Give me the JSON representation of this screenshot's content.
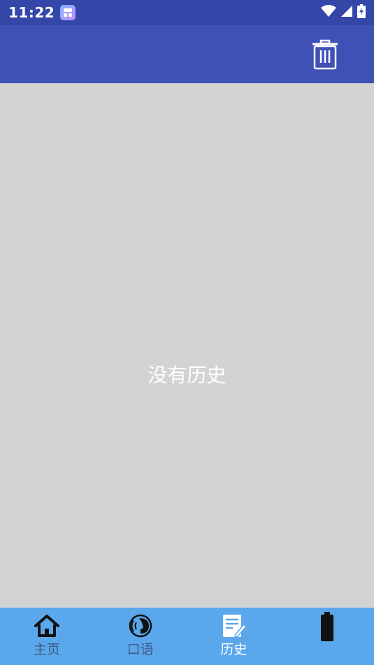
{
  "status_bar": {
    "time": "11:22",
    "icons": [
      "app-notification-icon",
      "wifi-icon",
      "signal-icon",
      "battery-charging-icon"
    ]
  },
  "toolbar": {
    "action_icon": "trash-icon"
  },
  "content": {
    "empty_message": "没有历史"
  },
  "bottom_nav": {
    "items": [
      {
        "label": "主页",
        "icon": "home-icon",
        "active": false
      },
      {
        "label": "口语",
        "icon": "speak-icon",
        "active": false
      },
      {
        "label": "历史",
        "icon": "history-icon",
        "active": true
      },
      {
        "label": "",
        "icon": "settings-icon",
        "active": false
      }
    ]
  },
  "colors": {
    "status_bar": "#3446a8",
    "toolbar": "#3f51b5",
    "content_bg": "#d3d3d3",
    "bottom_nav": "#5ba7ec",
    "nav_label": "#3a5b86",
    "active_label": "#ffffff"
  }
}
